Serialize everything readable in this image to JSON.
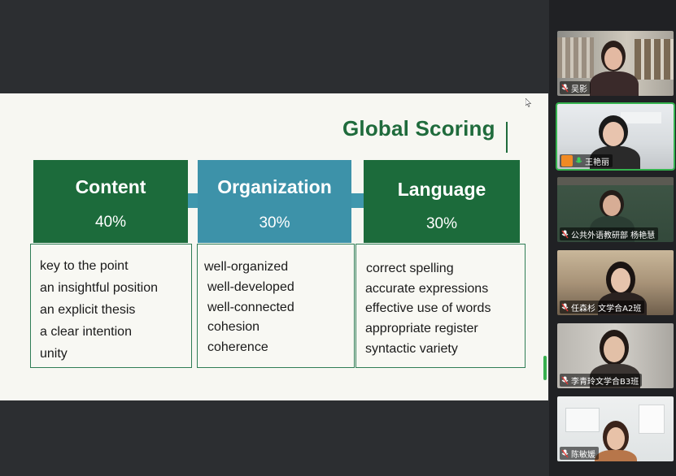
{
  "slide": {
    "title": "Global Scoring",
    "categories": [
      {
        "name": "Content",
        "percent": "40%",
        "items": [
          "key to the point",
          "an insightful position",
          "an explicit thesis",
          "a clear intention",
          "unity"
        ]
      },
      {
        "name": "Organization",
        "percent": "30%",
        "items": [
          "well-organized",
          "well-developed",
          "well-connected",
          "cohesion",
          "coherence"
        ]
      },
      {
        "name": "Language",
        "percent": "30%",
        "items": [
          "correct spelling",
          "accurate expressions",
          "effective use of words",
          "appropriate register",
          "syntactic variety"
        ]
      }
    ],
    "colors": {
      "green": "#1c6b3b",
      "blue": "#3d92a9",
      "title": "#1f6b3c"
    }
  },
  "participants": [
    {
      "name": "吴影",
      "icon": "mic-muted-icon"
    },
    {
      "name": "王艳丽",
      "icon": "mic-icon",
      "active": true
    },
    {
      "name": "公共外语教研部 杨艳慧",
      "icon": "mic-muted-icon"
    },
    {
      "name": "任森杉 文学合A2班",
      "icon": "mic-muted-icon"
    },
    {
      "name": "李青玲文学合B3班",
      "icon": "mic-muted-icon"
    },
    {
      "name": "陈敏媛",
      "icon": "mic-muted-icon"
    }
  ]
}
